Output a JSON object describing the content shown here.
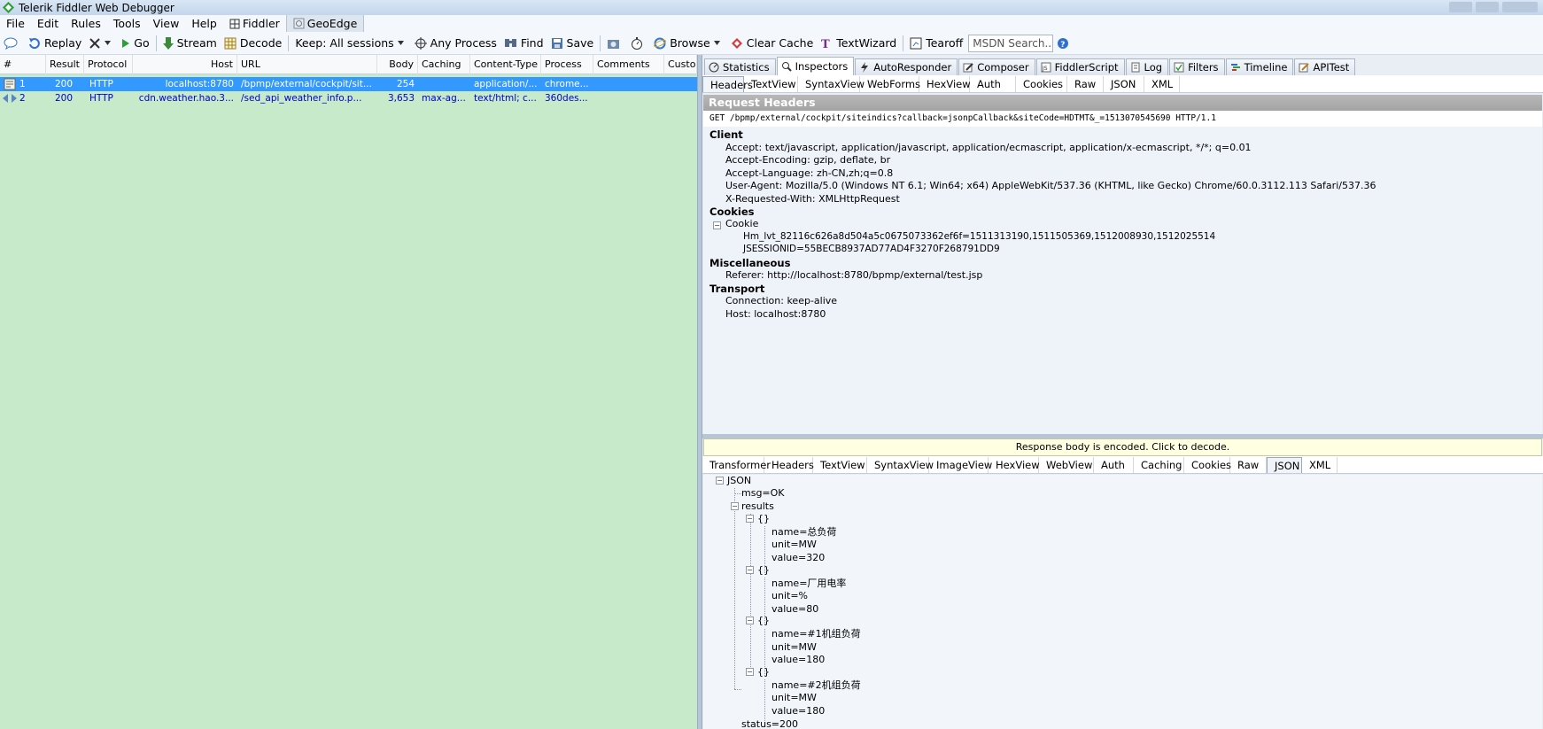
{
  "window": {
    "title": "Telerik Fiddler Web Debugger"
  },
  "menu": {
    "items": [
      "File",
      "Edit",
      "Rules",
      "Tools",
      "View",
      "Help",
      "Fiddler",
      "GeoEdge"
    ]
  },
  "toolbar": {
    "comment": "",
    "replay": "Replay",
    "remove": "",
    "go": "Go",
    "stream": "Stream",
    "decode": "Decode",
    "keep": "Keep: All sessions",
    "any_process": "Any Process",
    "find": "Find",
    "save": "Save",
    "browse": "Browse",
    "clear_cache": "Clear Cache",
    "textwizard": "TextWizard",
    "tearoff": "Tearoff",
    "msdn_placeholder": "MSDN Search..."
  },
  "sessions": {
    "columns": [
      "#",
      "Result",
      "Protocol",
      "Host",
      "URL",
      "Body",
      "Caching",
      "Content-Type",
      "Process",
      "Comments",
      "Custo"
    ],
    "rows": [
      {
        "num": "1",
        "result": "200",
        "protocol": "HTTP",
        "host": "localhost:8780",
        "url": "/bpmp/external/cockpit/sit...",
        "body": "254",
        "caching": "",
        "content_type": "application/...",
        "process": "chrome...",
        "comments": ""
      },
      {
        "num": "2",
        "result": "200",
        "protocol": "HTTP",
        "host": "cdn.weather.hao.3...",
        "url": "/sed_api_weather_info.p...",
        "body": "3,653",
        "caching": "max-ag...",
        "content_type": "text/html; c...",
        "process": "360des...",
        "comments": ""
      }
    ]
  },
  "top_tabs": [
    "Statistics",
    "Inspectors",
    "AutoResponder",
    "Composer",
    "FiddlerScript",
    "Log",
    "Filters",
    "Timeline",
    "APITest"
  ],
  "request_tabs": [
    "Headers",
    "TextView",
    "SyntaxView",
    "WebForms",
    "HexView",
    "Auth",
    "Cookies",
    "Raw",
    "JSON",
    "XML"
  ],
  "request": {
    "title": "Request Headers",
    "line": "GET /bpmp/external/cockpit/siteindics?callback=jsonpCallback&siteCode=HDTMT&_=1513070545690 HTTP/1.1",
    "client_label": "Client",
    "client": [
      "Accept: text/javascript, application/javascript, application/ecmascript, application/x-ecmascript, */*; q=0.01",
      "Accept-Encoding: gzip, deflate, br",
      "Accept-Language: zh-CN,zh;q=0.8",
      "User-Agent: Mozilla/5.0 (Windows NT 6.1; Win64; x64) AppleWebKit/537.36 (KHTML, like Gecko) Chrome/60.0.3112.113 Safari/537.36",
      "X-Requested-With: XMLHttpRequest"
    ],
    "cookies_label": "Cookies",
    "cookie_node": "Cookie",
    "cookies": [
      "Hm_lvt_82116c626a8d504a5c0675073362ef6f=1511313190,1511505369,1512008930,1512025514",
      "JSESSIONID=55BECB8937AD77AD4F3270F268791DD9"
    ],
    "misc_label": "Miscellaneous",
    "misc": [
      "Referer: http://localhost:8780/bpmp/external/test.jsp"
    ],
    "transport_label": "Transport",
    "transport": [
      "Connection: keep-alive",
      "Host: localhost:8780"
    ]
  },
  "response": {
    "notice": "Response body is encoded. Click to decode.",
    "tabs": [
      "Transformer",
      "Headers",
      "TextView",
      "SyntaxView",
      "ImageView",
      "HexView",
      "WebView",
      "Auth",
      "Caching",
      "Cookies",
      "Raw",
      "JSON",
      "XML"
    ],
    "json": {
      "root": "JSON",
      "msg": "msg=OK",
      "results": "results",
      "obj": "{}",
      "items": [
        [
          "name=总负荷",
          "unit=MW",
          "value=320"
        ],
        [
          "name=厂用电率",
          "unit=%",
          "value=80"
        ],
        [
          "name=#1机组负荷",
          "unit=MW",
          "value=180"
        ],
        [
          "name=#2机组负荷",
          "unit=MW",
          "value=180"
        ]
      ],
      "status": "status=200"
    }
  },
  "colors": {
    "selected_row": "#3399ff",
    "session_bg": "#c7ebca",
    "row_text": "#0000cd"
  }
}
